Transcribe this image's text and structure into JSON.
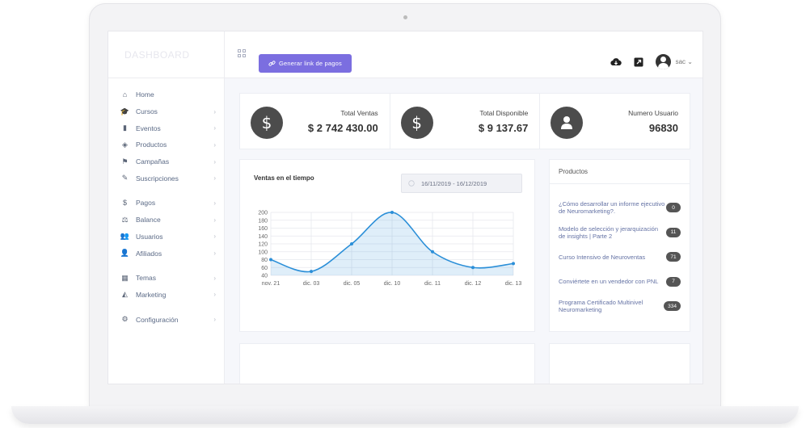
{
  "sidebar": {
    "brand": "DASHBOARD",
    "groups": [
      [
        {
          "label": "Home",
          "icon": "home-icon",
          "chevron": false
        },
        {
          "label": "Cursos",
          "icon": "graduation-cap-icon",
          "chevron": true
        },
        {
          "label": "Eventos",
          "icon": "bookmark-icon",
          "chevron": true
        },
        {
          "label": "Productos",
          "icon": "box-icon",
          "chevron": true
        },
        {
          "label": "Campañas",
          "icon": "flag-icon",
          "chevron": true
        },
        {
          "label": "Suscripciones",
          "icon": "edit-icon",
          "chevron": true
        }
      ],
      [
        {
          "label": "Pagos",
          "icon": "dollar-icon",
          "chevron": true
        },
        {
          "label": "Balance",
          "icon": "balance-scale-icon",
          "chevron": true
        },
        {
          "label": "Usuarios",
          "icon": "users-icon",
          "chevron": true
        },
        {
          "label": "Afiliados",
          "icon": "user-plus-icon",
          "chevron": true
        }
      ],
      [
        {
          "label": "Temas",
          "icon": "grid-icon",
          "chevron": true
        },
        {
          "label": "Marketing",
          "icon": "area-chart-icon",
          "chevron": true
        }
      ],
      [
        {
          "label": "Configuración",
          "icon": "gear-icon",
          "chevron": true
        }
      ]
    ]
  },
  "topbar": {
    "generate_button": "Generar link de pagos",
    "user_name": "sac"
  },
  "stats": [
    {
      "label": "Total Ventas",
      "value": "$ 2 742 430.00",
      "icon": "dollar-icon"
    },
    {
      "label": "Total Disponible",
      "value": "$ 9 137.67",
      "icon": "dollar-icon"
    },
    {
      "label": "Numero Usuario",
      "value": "96830",
      "icon": "user-icon"
    }
  ],
  "chart": {
    "title": "Ventas en el tiempo",
    "date_range": "16/11/2019 - 16/12/2019"
  },
  "chart_data": {
    "type": "area",
    "x": [
      "nov. 21",
      "dic. 03",
      "dic. 05",
      "dic. 10",
      "dic. 11",
      "dic. 12",
      "dic. 13"
    ],
    "series": [
      {
        "values": [
          80,
          50,
          120,
          200,
          100,
          60,
          70
        ]
      }
    ],
    "yticks": [
      40,
      60,
      80,
      100,
      120,
      140,
      160,
      180,
      200
    ],
    "ylim": [
      40,
      200
    ],
    "grid": true,
    "color": "#2b8fd8"
  },
  "products": {
    "title": "Productos",
    "items": [
      {
        "name": "¿Cómo desarrollar un informe ejecutivo de Neuromarketing?.",
        "count": "0"
      },
      {
        "name": "Modelo de selección y jerarquización de insights | Parte 2",
        "count": "11"
      },
      {
        "name": "Curso Intensivo de Neuroventas",
        "count": "71"
      },
      {
        "name": "Conviértete en un vendedor con PNL",
        "count": "7"
      },
      {
        "name": "Programa Certificado Multinivel Neuromarketing",
        "count": "334"
      }
    ]
  }
}
